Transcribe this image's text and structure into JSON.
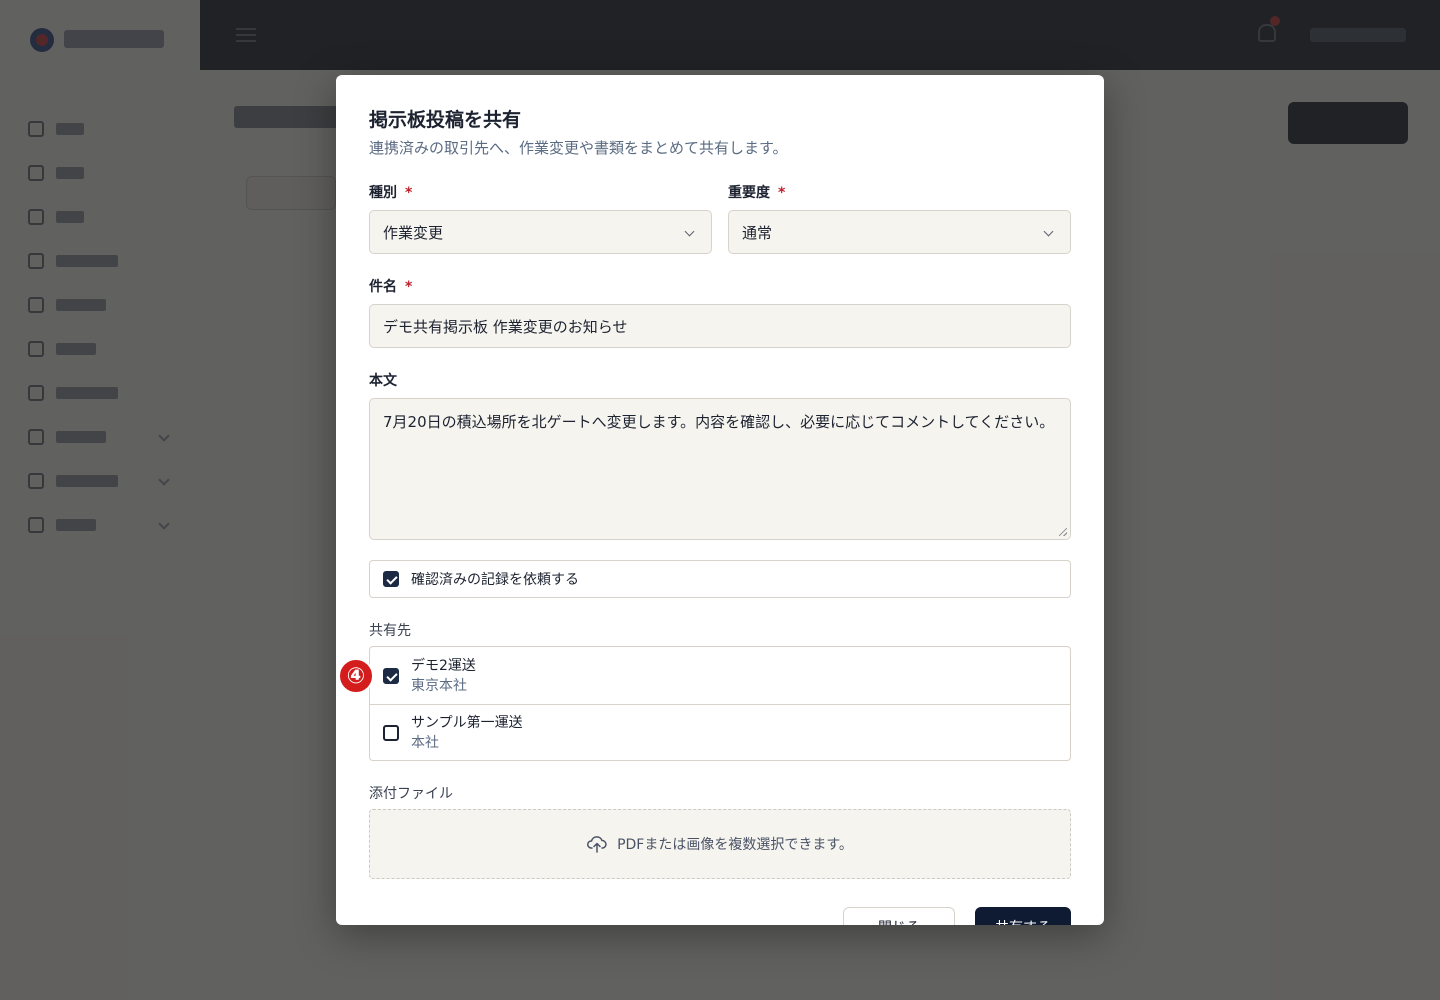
{
  "modal": {
    "title": "掲示板投稿を共有",
    "subtitle": "連携済みの取引先へ、作業変更や書類をまとめて共有します。",
    "type_label": "種別",
    "type_value": "作業変更",
    "priority_label": "重要度",
    "priority_value": "通常",
    "required_mark": "*",
    "subject_label": "件名",
    "subject_value": "デモ共有掲示板 作業変更のお知らせ",
    "body_label": "本文",
    "body_value": "7月20日の積込場所を北ゲートへ変更します。内容を確認し、必要に応じてコメントしてください。",
    "confirm_label": "確認済みの記録を依頼する",
    "confirm_checked": true,
    "share_label": "共有先",
    "share_targets": [
      {
        "name": "デモ2運送",
        "branch": "東京本社",
        "checked": true
      },
      {
        "name": "サンプル第一運送",
        "branch": "本社",
        "checked": false
      }
    ],
    "attachment_label": "添付ファイル",
    "attachment_hint": "PDFまたは画像を複数選択できます。",
    "cancel_label": "閉じる",
    "submit_label": "共有する"
  },
  "annotation": {
    "step": "④"
  },
  "colors": {
    "accent": "#0f1b33",
    "required": "#c0202a",
    "badge": "#d41c1c"
  }
}
